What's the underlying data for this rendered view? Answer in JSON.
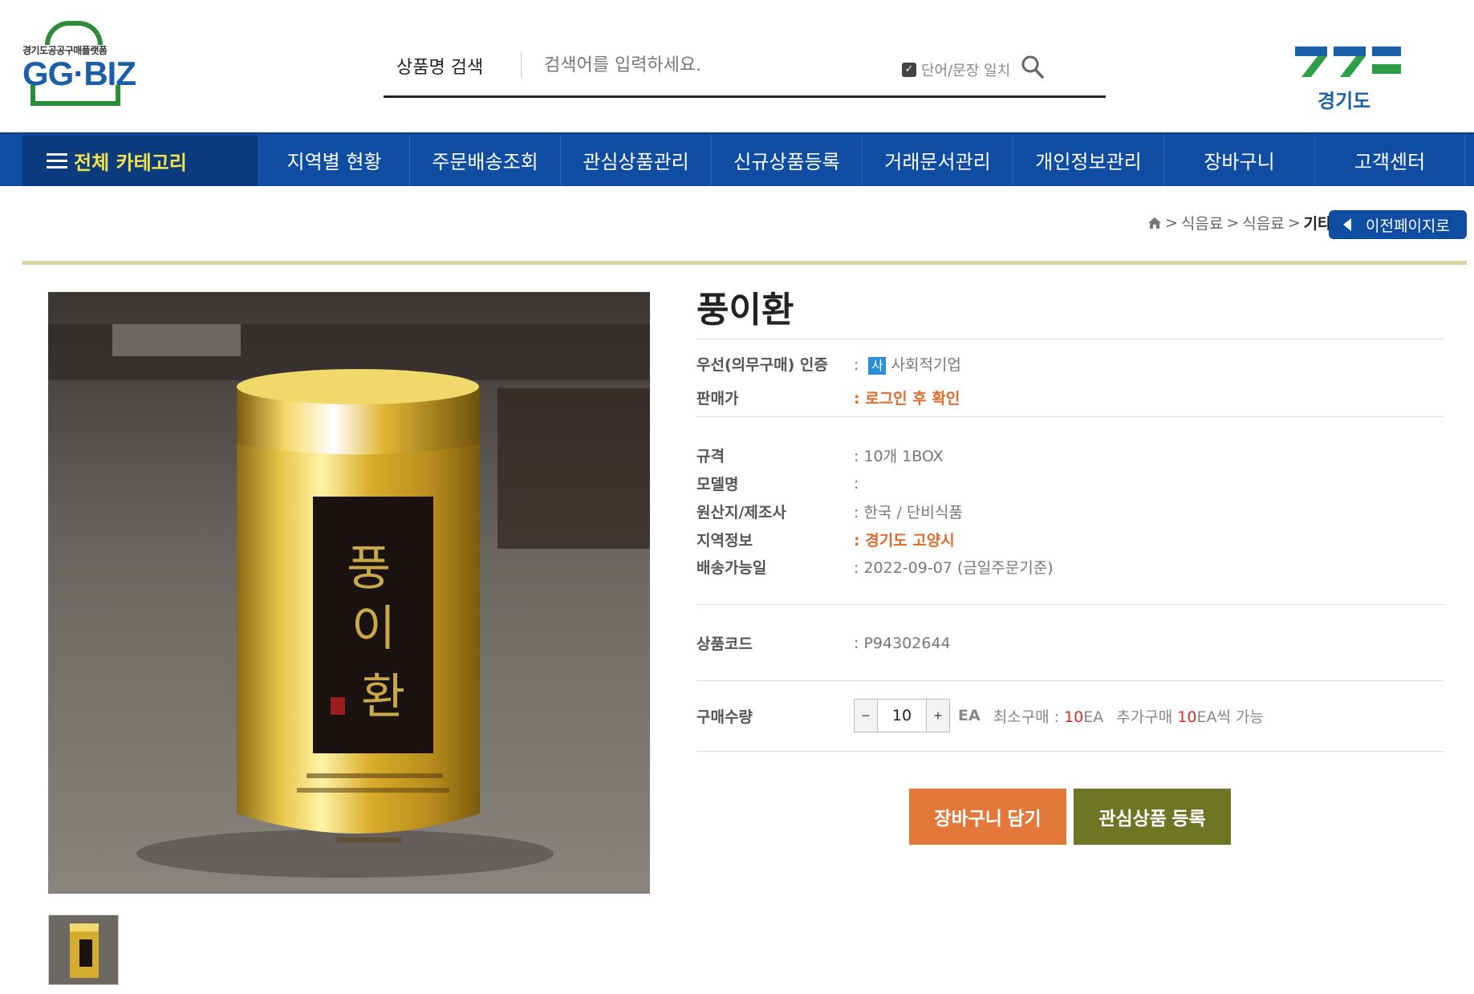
{
  "header": {
    "logo_small": "경기도공공구매플랫폼",
    "logo_big": "GG·BIZ",
    "search_label": "상품명 검색",
    "search_placeholder": "검색어를 입력하세요.",
    "exact_match_label": "단어/문장 일치",
    "gyeonggi_logo_text": "경기도"
  },
  "nav": {
    "all_categories": "전체 카테고리",
    "items": [
      "지역별 현황",
      "주문배송조회",
      "관심상품관리",
      "신규상품등록",
      "거래문서관리",
      "개인정보관리",
      "장바구니",
      "고객센터"
    ]
  },
  "breadcrumb": {
    "items": [
      "식음료",
      "식음료",
      "기타"
    ],
    "back_label": "이전페이지로"
  },
  "product": {
    "title": "풍이환",
    "can_title": "풍이환",
    "cert_label": "우선(의무구매) 인증",
    "cert_badge": "사",
    "cert_value": "사회적기업",
    "price_label": "판매가",
    "price_value": "로그인 후 확인",
    "spec_label": "규격",
    "spec_value": "10개 1BOX",
    "model_label": "모델명",
    "model_value": "",
    "origin_label": "원산지/제조사",
    "origin_value": "한국 / 단비식품",
    "region_label": "지역정보",
    "region_value": "경기도 고양시",
    "delivery_label": "배송가능일",
    "delivery_value": "2022-09-07 (금일주문기준)",
    "code_label": "상품코드",
    "code_value": "P94302644",
    "qty_label": "구매수량",
    "qty_value": "10",
    "qty_unit": "EA",
    "min_order_prefix": "최소구매 : ",
    "min_order_num": "10",
    "min_order_unit": "EA",
    "add_order_prefix": "추가구매 ",
    "add_order_num": "10",
    "add_order_suffix": "EA씩 가능",
    "cart_button": "장바구니 담기",
    "wishlist_button": "관심상품 등록"
  },
  "colors": {
    "nav_blue": "#0f4da2",
    "accent_orange": "#e06a2b",
    "cart_orange": "#e4783b",
    "wish_olive": "#6e7523",
    "gold_divider": "#d7d3a1"
  }
}
